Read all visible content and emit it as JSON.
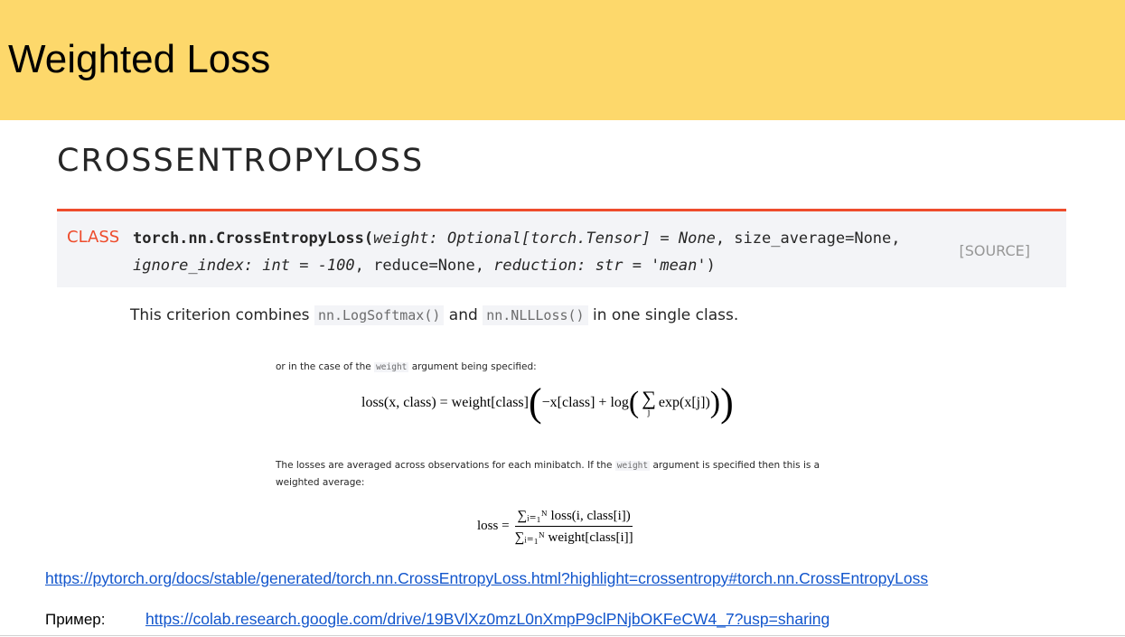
{
  "slide": {
    "title": "Weighted Loss"
  },
  "doc": {
    "heading": "CROSSENTROPYLOSS",
    "signature": {
      "class_label": "CLASS",
      "name": "torch.nn.CrossEntropyLoss(",
      "line1_args": "weight: Optional[torch.Tensor] = None",
      "line1_rest": ", size_average=None,",
      "line2_a": "ignore_index: int = -100",
      "line2_b": ", reduce=None, ",
      "line2_c": "reduction: str = 'mean'",
      "line2_end": ")",
      "source_label": "[SOURCE]"
    },
    "criterion": {
      "prefix": "This criterion combines ",
      "code1": "nn.LogSoftmax()",
      "middle": " and ",
      "code2": "nn.NLLLoss()",
      "suffix": " in one single class."
    },
    "weight_case": {
      "prefix": "or in the case of the ",
      "code": "weight",
      "suffix": " argument being specified:"
    },
    "formula1": {
      "lhs": "loss(x, class) = weight[class]",
      "inner": "−x[class] + log",
      "sum_sub": "j",
      "exp": "exp(x[j])"
    },
    "averaged": {
      "prefix": "The losses are averaged across observations for each minibatch. If the ",
      "code": "weight",
      "suffix": " argument is specified then this is a",
      "line2": "weighted average:"
    },
    "formula2": {
      "lhs": "loss =",
      "numerator": "∑ᵢ₌₁ᴺ loss(i, class[i])",
      "denominator": "∑ᵢ₌₁ᴺ weight[class[i]]"
    }
  },
  "links": {
    "docs_url": "https://pytorch.org/docs/stable/generated/torch.nn.CrossEntropyLoss.html?highlight=crossentropy#torch.nn.CrossEntropyLoss",
    "example_label": "Пример:",
    "example_url": "https://colab.research.google.com/drive/19BVlXz0mzL0nXmpP9clPNjbOKFeCW4_7?usp=sharing"
  },
  "colors": {
    "header_bg": "#fdd86b",
    "accent": "#ee4c2c",
    "link": "#1155cc"
  }
}
